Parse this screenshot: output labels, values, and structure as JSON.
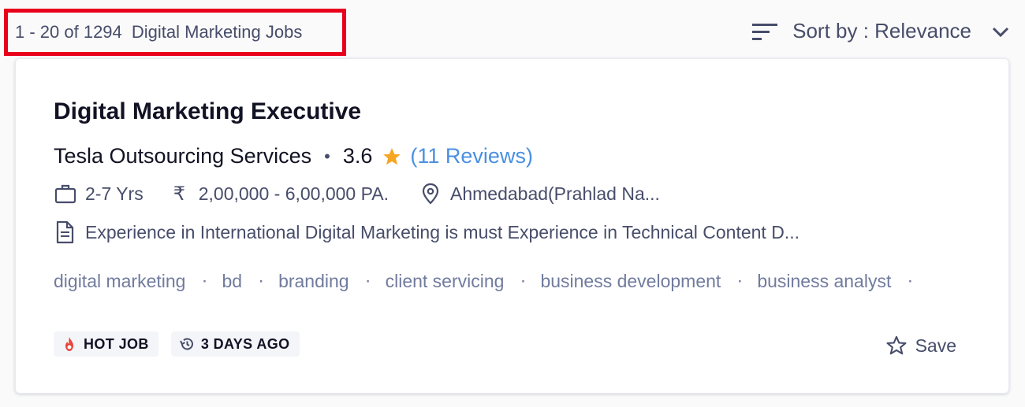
{
  "results": {
    "range": "1 - 20 of 1294",
    "keyword": "Digital Marketing Jobs"
  },
  "sort": {
    "label": "Sort by : Relevance",
    "icon": "sort-icon"
  },
  "job": {
    "title": "Digital Marketing Executive",
    "company": "Tesla Outsourcing Services",
    "rating": "3.6",
    "reviews": "(11 Reviews)",
    "experience": "2-7 Yrs",
    "currency_symbol": "₹",
    "salary": "2,00,000 - 6,00,000 PA.",
    "location": "Ahmedabad(Prahlad Na...",
    "description": "Experience in International Digital Marketing is must Experience in Technical Content D...",
    "tags": [
      "digital marketing",
      "bd",
      "branding",
      "client servicing",
      "business development",
      "business analyst"
    ],
    "badges": {
      "hot": "HOT JOB",
      "posted": "3 DAYS AGO"
    },
    "save_label": "Save"
  },
  "colors": {
    "highlight_border": "#e8001c",
    "link_blue": "#4a90e2",
    "star": "#f5a623",
    "fire": "#e8453c"
  }
}
